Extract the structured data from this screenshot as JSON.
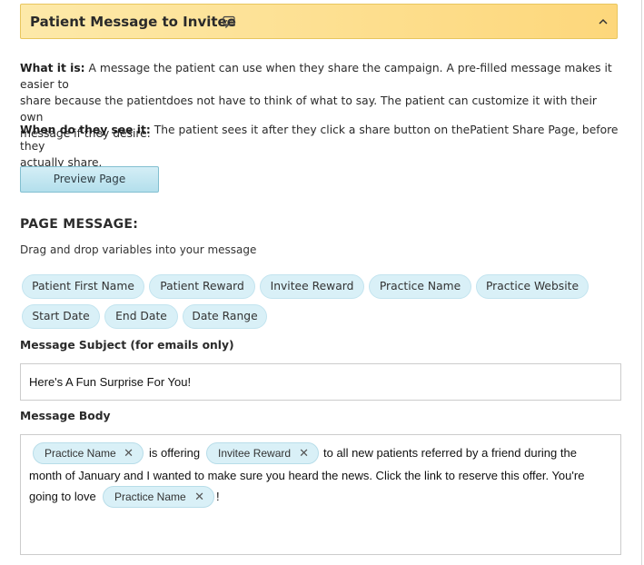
{
  "header": {
    "title": "Patient Message to Invitee",
    "icon": "chat-bubble-icon",
    "toggle_icon": "chevron-up-icon",
    "background": "#fdd77b"
  },
  "info": {
    "what_label": "What it is:",
    "what_line1": " A message the patient can use when they share the campaign. A pre-filled message makes it easier to",
    "what_line2": "share because the patientdoes not have to think of what to say. The patient can customize it with their own",
    "what_line3": "message if they desire.",
    "when_label": "When do they see it:",
    "when_line1": " The patient sees it after they click a share button on thePatient Share Page, before they",
    "when_line2": "actually share."
  },
  "preview_button": "Preview Page",
  "page_message": {
    "title": "PAGE MESSAGE:",
    "hint": "Drag and drop variables into your message",
    "variables": [
      "Patient First Name",
      "Patient Reward",
      "Invitee Reward",
      "Practice Name",
      "Practice Website",
      "Start Date",
      "End Date",
      "Date Range"
    ]
  },
  "subject": {
    "label": "Message Subject (for emails only)",
    "value": "Here's A Fun Surprise For You!"
  },
  "body": {
    "label": "Message Body",
    "token1": "Practice Name",
    "text1": "is offering",
    "token2": "Invitee Reward",
    "text2": "to all new patients referred by a friend during the",
    "line2": "month of January and I wanted to make sure you heard the news. Click the link to reserve this offer. You're",
    "text3": "going to love",
    "token3": "Practice Name",
    "text4": "!",
    "remove_glyph": "✕"
  },
  "colors": {
    "chip_bg": "#d9f0f7",
    "accent_border": "#e8c65e"
  }
}
